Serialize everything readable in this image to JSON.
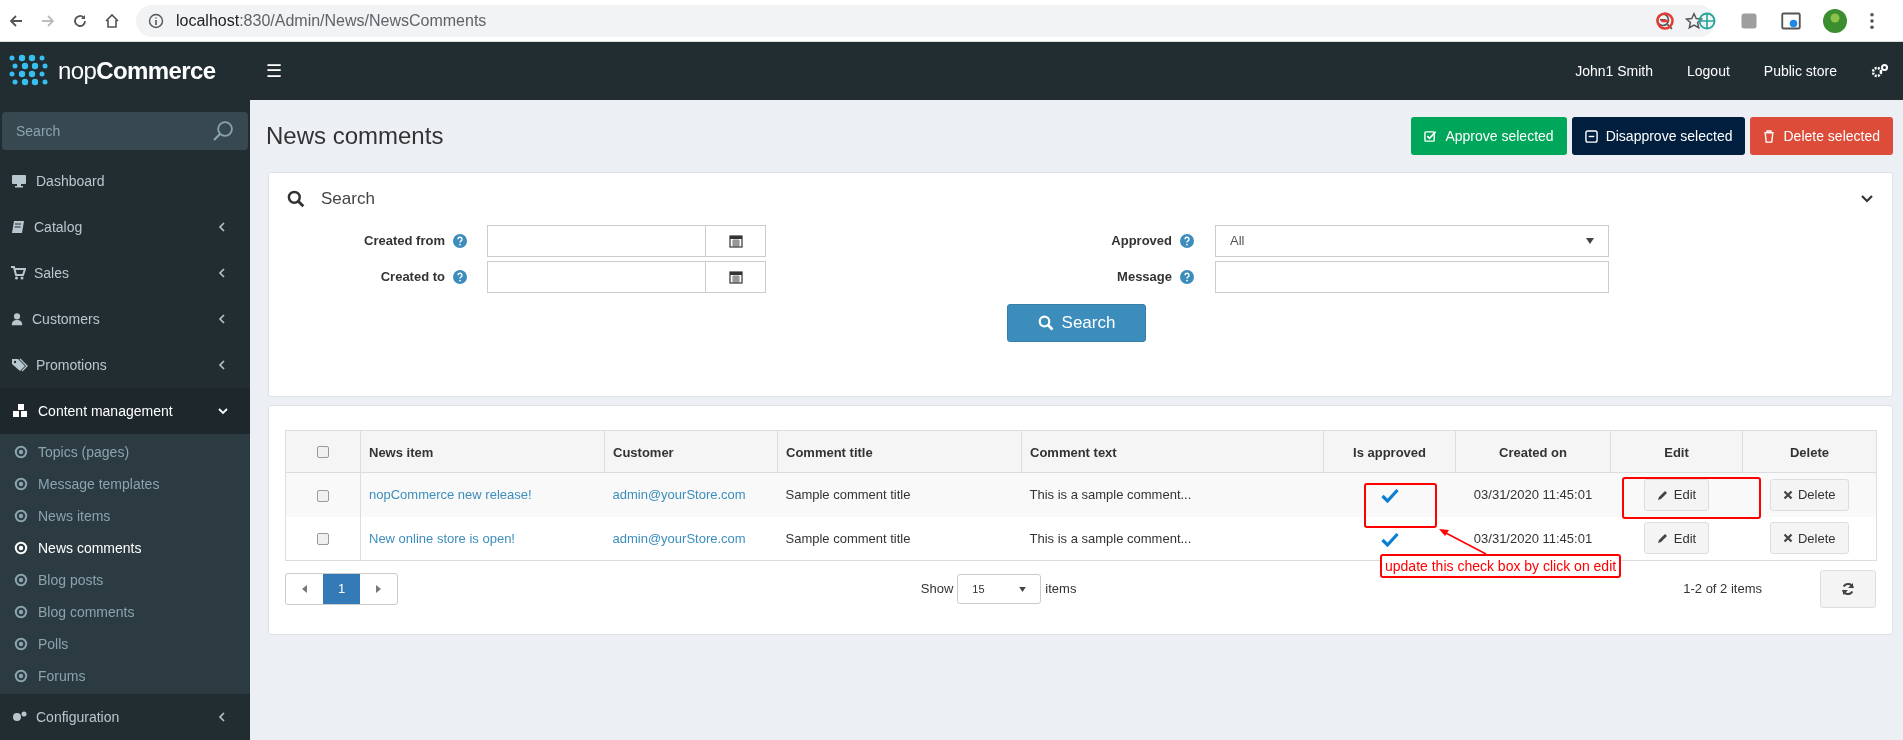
{
  "browser": {
    "url_host": "localhost",
    "url_path": ":830/Admin/News/NewsComments"
  },
  "header": {
    "logo_light": "nop",
    "logo_bold": "Commerce",
    "menu_icon": "☰",
    "user": "John1 Smith",
    "links": [
      "Logout",
      "Public store"
    ]
  },
  "sidebar": {
    "search_placeholder": "Search",
    "items": [
      {
        "label": "Dashboard",
        "expanded": false,
        "has_children": false
      },
      {
        "label": "Catalog",
        "expanded": false,
        "has_children": true
      },
      {
        "label": "Sales",
        "expanded": false,
        "has_children": true
      },
      {
        "label": "Customers",
        "expanded": false,
        "has_children": true
      },
      {
        "label": "Promotions",
        "expanded": false,
        "has_children": true
      },
      {
        "label": "Content management",
        "expanded": true,
        "has_children": true,
        "children": [
          {
            "label": "Topics (pages)",
            "selected": false
          },
          {
            "label": "Message templates",
            "selected": false
          },
          {
            "label": "News items",
            "selected": false
          },
          {
            "label": "News comments",
            "selected": true
          },
          {
            "label": "Blog posts",
            "selected": false
          },
          {
            "label": "Blog comments",
            "selected": false
          },
          {
            "label": "Polls",
            "selected": false
          },
          {
            "label": "Forums",
            "selected": false
          }
        ]
      },
      {
        "label": "Configuration",
        "expanded": false,
        "has_children": true
      }
    ]
  },
  "page_title": "News comments",
  "actions": [
    {
      "label": "Approve selected",
      "kind": "approve"
    },
    {
      "label": "Disapprove selected",
      "kind": "disapprove"
    },
    {
      "label": "Delete selected",
      "kind": "delete"
    }
  ],
  "search_panel": {
    "title": "Search",
    "created_from": "Created from",
    "created_to": "Created to",
    "approved": "Approved",
    "approved_value": "All",
    "message": "Message",
    "button": "Search"
  },
  "table": {
    "select_all_checked": false,
    "columns": [
      "News item",
      "Customer",
      "Comment title",
      "Comment text",
      "Is approved",
      "Created on",
      "Edit",
      "Delete"
    ],
    "rows": [
      {
        "checked": false,
        "news_item": "nopCommerce new release!",
        "customer": "admin@yourStore.com",
        "title": "Sample comment title",
        "text": "This is a sample comment...",
        "approved": true,
        "created": "03/31/2020 11:45:01",
        "edit": "Edit",
        "delete": "Delete"
      },
      {
        "checked": false,
        "news_item": "New online store is open!",
        "customer": "admin@yourStore.com",
        "title": "Sample comment title",
        "text": "This is a sample comment...",
        "approved": true,
        "created": "03/31/2020 11:45:01",
        "edit": "Edit",
        "delete": "Delete"
      }
    ]
  },
  "pager": {
    "pages": [
      {
        "label": "1",
        "selected": true
      }
    ],
    "show": "Show",
    "page_size": "15",
    "items": "items",
    "summary": "1-2 of 2 items"
  },
  "annotation": {
    "note": "update this check box by click on edit"
  }
}
